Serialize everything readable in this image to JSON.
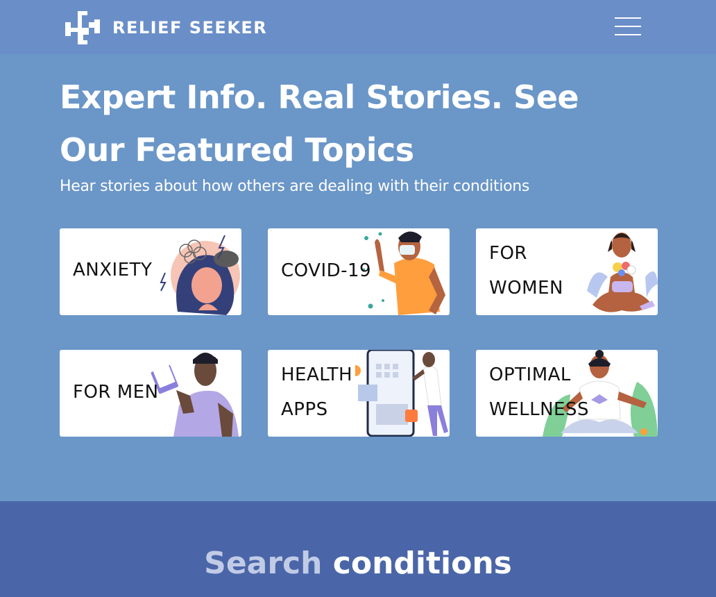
{
  "header": {
    "logo_text": "RELIEF SEEKER",
    "logo_icon": "cross-logo-icon",
    "menu_icon": "hamburger-menu-icon"
  },
  "hero": {
    "title": "Expert Info. Real Stories. See Our Featured Topics",
    "subtitle": "Hear stories about how others are dealing with their conditions"
  },
  "topics": [
    {
      "line1": "ANXIETY",
      "line2": ""
    },
    {
      "line1": "COVID-19",
      "line2": ""
    },
    {
      "line1": "FOR",
      "line2": "WOMEN"
    },
    {
      "line1": "FOR MEN",
      "line2": ""
    },
    {
      "line1": "HEALTH",
      "line2": "APPS"
    },
    {
      "line1": "OPTIMAL",
      "line2": "WELLNESS"
    }
  ],
  "search": {
    "title_word1": "Search",
    "title_word2": "conditions"
  },
  "colors": {
    "header_bg": "#6a8ec8",
    "page_bg": "#6a96c8",
    "search_bg": "#4a66a8",
    "search_word1": "#c2cbe6"
  }
}
